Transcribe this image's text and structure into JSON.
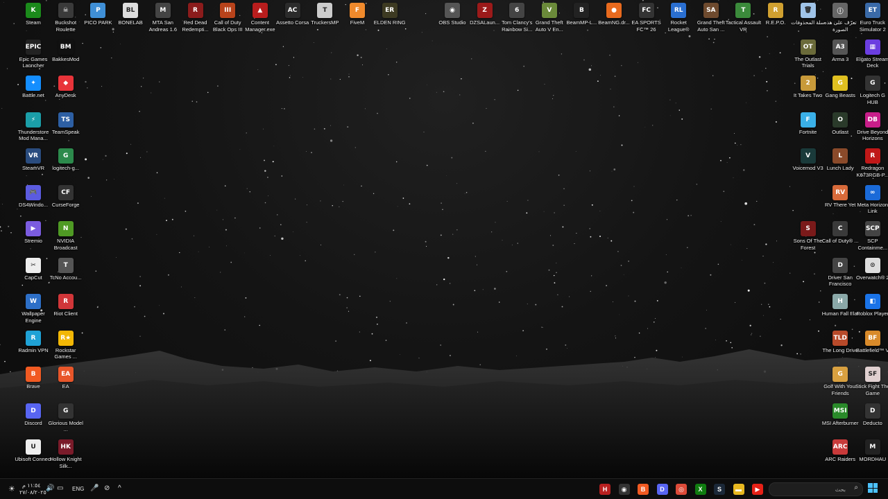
{
  "colors": {
    "accent": "#4cc2ff",
    "label_text": "#f2f2f2",
    "taskbar_bg": "#0e0e0e"
  },
  "desktop": {
    "icons": [
      {
        "id": "steam",
        "label": "Steam",
        "col": 0,
        "row": 0,
        "color": "#1b8a1b",
        "glyph": "K",
        "icon": "kick-steam-icon"
      },
      {
        "id": "buckshot-roulette",
        "label": "Buckshot Roulette",
        "col": 1,
        "row": 0,
        "color": "#3a3a3a",
        "glyph": "☠",
        "icon": "skull-icon"
      },
      {
        "id": "pico-park",
        "label": "PICO PARK",
        "col": 2,
        "row": 0,
        "color": "#3f8fd6",
        "glyph": "P",
        "icon": "pico-park-icon"
      },
      {
        "id": "bonelab",
        "label": "BONELAB",
        "col": 3,
        "row": 0,
        "color": "#ddd",
        "glyph": "BL",
        "icon": "bonelab-icon"
      },
      {
        "id": "mta-sa",
        "label": "MTA San Andreas 1.6",
        "col": 4,
        "row": 0,
        "color": "#444",
        "glyph": "M",
        "icon": "mta-icon"
      },
      {
        "id": "rdr",
        "label": "Red Dead Redempti...",
        "col": 5,
        "row": 0,
        "color": "#8b1c1c",
        "glyph": "R",
        "icon": "rdr-icon"
      },
      {
        "id": "cod-bo3",
        "label": "Call of Duty Black Ops III",
        "col": 6,
        "row": 0,
        "color": "#b8431b",
        "glyph": "III",
        "icon": "cod-icon"
      },
      {
        "id": "content-manager",
        "label": "Content Manager.exe",
        "col": 7,
        "row": 0,
        "color": "#b81d1d",
        "glyph": "▲",
        "icon": "content-manager-icon"
      },
      {
        "id": "assetto-corsa",
        "label": "Assetto Corsa",
        "col": 8,
        "row": 0,
        "color": "#2b2b2b",
        "glyph": "AC",
        "icon": "assetto-icon"
      },
      {
        "id": "truckersmp",
        "label": "TruckersMP",
        "col": 9,
        "row": 0,
        "color": "#ccc",
        "glyph": "T",
        "icon": "truck-icon"
      },
      {
        "id": "fivem",
        "label": "FiveM",
        "col": 10,
        "row": 0,
        "color": "#f08a2c",
        "glyph": "F",
        "icon": "fivem-icon"
      },
      {
        "id": "elden-ring",
        "label": "ELDEN RING",
        "col": 11,
        "row": 0,
        "color": "#3d3a22",
        "glyph": "ER",
        "icon": "elden-ring-icon"
      },
      {
        "id": "obs",
        "label": "OBS Studio",
        "col": 13,
        "row": 0,
        "color": "#555",
        "glyph": "◉",
        "icon": "obs-icon"
      },
      {
        "id": "dzsa",
        "label": "DZSALaun...",
        "col": 14,
        "row": 0,
        "color": "#9b1a1a",
        "glyph": "Z",
        "icon": "dzsa-icon"
      },
      {
        "id": "rainbow-six",
        "label": "Tom Clancy's Rainbow Si...",
        "col": 15,
        "row": 0,
        "color": "#444",
        "glyph": "6",
        "icon": "rainbow-six-icon"
      },
      {
        "id": "gta5-en",
        "label": "Grand Theft Auto V En...",
        "col": 16,
        "row": 0,
        "color": "#6b8a3a",
        "glyph": "V",
        "icon": "gta-v-icon"
      },
      {
        "id": "beammp",
        "label": "BeamMP-L...",
        "col": 17,
        "row": 0,
        "color": "#222",
        "glyph": "B",
        "icon": "beammp-icon"
      },
      {
        "id": "beamng",
        "label": "BeamNG.dr...",
        "col": 18,
        "row": 0,
        "color": "#e86a1e",
        "glyph": "●",
        "icon": "beamng-icon"
      },
      {
        "id": "ea-fc26",
        "label": "EA SPORTS FC™ 26",
        "col": 19,
        "row": 0,
        "color": "#333",
        "glyph": "FC",
        "icon": "ea-fc-icon"
      },
      {
        "id": "rocket-league",
        "label": "Rocket League®",
        "col": 20,
        "row": 0,
        "color": "#2a6fd1",
        "glyph": "RL",
        "icon": "rocket-league-icon"
      },
      {
        "id": "gta-sa",
        "label": "Grand Theft Auto San ...",
        "col": 21,
        "row": 0,
        "color": "#6e4a2e",
        "glyph": "SA",
        "icon": "gta-sa-icon"
      },
      {
        "id": "tactical-assault",
        "label": "Tactical Assault VR",
        "col": 22,
        "row": 0,
        "color": "#3b8a3b",
        "glyph": "T",
        "icon": "tactical-icon"
      },
      {
        "id": "repo",
        "label": "R.E.P.O.",
        "col": 23,
        "row": 0,
        "color": "#d0a030",
        "glyph": "R",
        "icon": "repo-icon"
      },
      {
        "id": "recycle-bin",
        "label": "سلة المحذوفات",
        "col": 24,
        "row": 0,
        "color": "#a0c4e8",
        "glyph": "🗑",
        "icon": "recycle-bin-icon"
      },
      {
        "id": "about-image",
        "label": "تعرّف على هذه الصورة",
        "col": 25,
        "row": 0,
        "color": "#666",
        "glyph": "ⓘ",
        "icon": "info-icon"
      },
      {
        "id": "ets2",
        "label": "Euro Truck Simulator 2",
        "col": 26,
        "row": 0,
        "color": "#3a6aa8",
        "glyph": "ET",
        "icon": "ets2-icon"
      },
      {
        "id": "epic",
        "label": "Epic Games Launcher",
        "col": 0,
        "row": 1,
        "color": "#222",
        "glyph": "EPIC",
        "icon": "epic-games-icon"
      },
      {
        "id": "bakkesmod",
        "label": "BakkesMod",
        "col": 1,
        "row": 1,
        "color": "#111",
        "glyph": "BM",
        "icon": "bakkesmod-icon"
      },
      {
        "id": "battlenet",
        "label": "Battle.net",
        "col": 0,
        "row": 2,
        "color": "#148eff",
        "glyph": "✦",
        "icon": "battlenet-icon"
      },
      {
        "id": "anydesk",
        "label": "AnyDesk",
        "col": 1,
        "row": 2,
        "color": "#e8343a",
        "glyph": "◆",
        "icon": "anydesk-icon"
      },
      {
        "id": "thunderstore",
        "label": "Thunderstore Mod Mana...",
        "col": 0,
        "row": 3,
        "color": "#1b9ea8",
        "glyph": "⚡",
        "icon": "thunderstore-icon"
      },
      {
        "id": "teamspeak",
        "label": "TeamSpeak",
        "col": 1,
        "row": 3,
        "color": "#2d5fa3",
        "glyph": "TS",
        "icon": "teamspeak-icon"
      },
      {
        "id": "steamvr",
        "label": "SteamVR",
        "col": 0,
        "row": 4,
        "color": "#2a4c7e",
        "glyph": "VR",
        "icon": "steamvr-icon"
      },
      {
        "id": "logitech-g",
        "label": "logitech-g...",
        "col": 1,
        "row": 4,
        "color": "#2c8a4c",
        "glyph": "G",
        "icon": "logitech-g-icon"
      },
      {
        "id": "ds4windows",
        "label": "DS4Windo...",
        "col": 0,
        "row": 5,
        "color": "#5b5be0",
        "glyph": "🎮",
        "icon": "gamepad-icon"
      },
      {
        "id": "curseforge",
        "label": "CurseForge",
        "col": 1,
        "row": 5,
        "color": "#333",
        "glyph": "CF",
        "icon": "curseforge-icon"
      },
      {
        "id": "stremio",
        "label": "Stremio",
        "col": 0,
        "row": 6,
        "color": "#7b5ce0",
        "glyph": "▶",
        "icon": "stremio-icon"
      },
      {
        "id": "nvidia",
        "label": "NVIDIA Broadcast",
        "col": 1,
        "row": 6,
        "color": "#4f9a24",
        "glyph": "N",
        "icon": "nvidia-icon"
      },
      {
        "id": "capcut",
        "label": "CapCut",
        "col": 0,
        "row": 7,
        "color": "#eee",
        "glyph": "✂",
        "icon": "capcut-icon"
      },
      {
        "id": "tcno",
        "label": "TcNo Accou...",
        "col": 1,
        "row": 7,
        "color": "#555",
        "glyph": "T",
        "icon": "tcno-icon"
      },
      {
        "id": "wallpaper-engine",
        "label": "Wallpaper Engine",
        "col": 0,
        "row": 8,
        "color": "#2d6fc7",
        "glyph": "W",
        "icon": "wallpaper-engine-icon"
      },
      {
        "id": "riot",
        "label": "Riot Client",
        "col": 1,
        "row": 8,
        "color": "#d13639",
        "glyph": "R",
        "icon": "riot-icon"
      },
      {
        "id": "radmin",
        "label": "Radmin VPN",
        "col": 0,
        "row": 9,
        "color": "#1fa2d6",
        "glyph": "R",
        "icon": "radmin-icon"
      },
      {
        "id": "rockstar",
        "label": "Rockstar Games ...",
        "col": 1,
        "row": 9,
        "color": "#f2b705",
        "glyph": "R★",
        "icon": "rockstar-icon"
      },
      {
        "id": "brave",
        "label": "Brave",
        "col": 0,
        "row": 10,
        "color": "#f15a22",
        "glyph": "B",
        "icon": "brave-icon"
      },
      {
        "id": "ea",
        "label": "EA",
        "col": 1,
        "row": 10,
        "color": "#e8562a",
        "glyph": "EA",
        "icon": "ea-icon"
      },
      {
        "id": "discord",
        "label": "Discord",
        "col": 0,
        "row": 11,
        "color": "#5865f2",
        "glyph": "D",
        "icon": "discord-icon"
      },
      {
        "id": "glorious",
        "label": "Glorious Model ...",
        "col": 1,
        "row": 11,
        "color": "#333",
        "glyph": "G",
        "icon": "glorious-icon"
      },
      {
        "id": "ubisoft",
        "label": "Ubisoft Connect",
        "col": 0,
        "row": 12,
        "color": "#eee",
        "glyph": "U",
        "icon": "ubisoft-icon"
      },
      {
        "id": "hollow-knight",
        "label": "Hollow Knight Silk...",
        "col": 1,
        "row": 12,
        "color": "#7a1b2a",
        "glyph": "HK",
        "icon": "hollow-knight-icon"
      },
      {
        "id": "outlast-trials",
        "label": "The Outlast Trials",
        "col": 24,
        "row": 1,
        "color": "#6b6b3a",
        "glyph": "OT",
        "icon": "outlast-trials-icon"
      },
      {
        "id": "arma3",
        "label": "Arma 3",
        "col": 25,
        "row": 1,
        "color": "#555",
        "glyph": "A3",
        "icon": "arma3-icon"
      },
      {
        "id": "stream-deck",
        "label": "Elgato Stream Deck",
        "col": 26,
        "row": 1,
        "color": "#6b3ee0",
        "glyph": "▦",
        "icon": "stream-deck-icon"
      },
      {
        "id": "it-takes-two",
        "label": "It Takes Two",
        "col": 24,
        "row": 2,
        "color": "#c89a3a",
        "glyph": "2",
        "icon": "it-takes-two-icon"
      },
      {
        "id": "gang-beasts",
        "label": "Gang Beasts",
        "col": 25,
        "row": 2,
        "color": "#e0c020",
        "glyph": "G",
        "icon": "gang-beasts-icon"
      },
      {
        "id": "logitech-ghub",
        "label": "Logitech G HUB",
        "col": 26,
        "row": 2,
        "color": "#333",
        "glyph": "G",
        "icon": "ghub-icon"
      },
      {
        "id": "fortnite",
        "label": "Fortnite",
        "col": 24,
        "row": 3,
        "color": "#3ab0e8",
        "glyph": "F",
        "icon": "fortnite-icon"
      },
      {
        "id": "outlast",
        "label": "Outlast",
        "col": 25,
        "row": 3,
        "color": "#2a3a2a",
        "glyph": "O",
        "icon": "outlast-icon"
      },
      {
        "id": "drive-beyond",
        "label": "Drive Beyond Horizons",
        "col": 26,
        "row": 3,
        "color": "#c81e8a",
        "glyph": "DB",
        "icon": "drive-beyond-icon"
      },
      {
        "id": "voicemod",
        "label": "Voicemod V3",
        "col": 24,
        "row": 4,
        "color": "#1a3a3a",
        "glyph": "V",
        "icon": "voicemod-icon"
      },
      {
        "id": "lunch-lady",
        "label": "Lunch Lady",
        "col": 25,
        "row": 4,
        "color": "#8a4a2a",
        "glyph": "L",
        "icon": "lunch-lady-icon"
      },
      {
        "id": "redragon",
        "label": "Redragon K673RGB-P...",
        "col": 26,
        "row": 4,
        "color": "#c01818",
        "glyph": "R",
        "icon": "redragon-icon"
      },
      {
        "id": "rv-there-yet",
        "label": "RV There Yet",
        "col": 25,
        "row": 5,
        "color": "#d86a3a",
        "glyph": "RV",
        "icon": "rv-icon"
      },
      {
        "id": "meta-horizon",
        "label": "Meta Horizon Link",
        "col": 26,
        "row": 5,
        "color": "#1a6ad8",
        "glyph": "∞",
        "icon": "meta-icon"
      },
      {
        "id": "sons-forest",
        "label": "Sons Of The Forest",
        "col": 24,
        "row": 6,
        "color": "#7a1a1a",
        "glyph": "S",
        "icon": "sons-forest-icon"
      },
      {
        "id": "cod",
        "label": "Call of Duty® ...",
        "col": 25,
        "row": 6,
        "color": "#3a3a3a",
        "glyph": "C",
        "icon": "cod-hq-icon"
      },
      {
        "id": "scp",
        "label": "SCP Containme...",
        "col": 26,
        "row": 6,
        "color": "#444",
        "glyph": "SCP",
        "icon": "scp-icon"
      },
      {
        "id": "driver-sf",
        "label": "Driver San Francisco",
        "col": 25,
        "row": 7,
        "color": "#444",
        "glyph": "D",
        "icon": "driver-icon"
      },
      {
        "id": "overwatch",
        "label": "Overwatch® 2",
        "col": 26,
        "row": 7,
        "color": "#ddd",
        "glyph": "⊙",
        "icon": "overwatch-icon"
      },
      {
        "id": "human-fall-flat",
        "label": "Human Fall Flat",
        "col": 25,
        "row": 8,
        "color": "#8aa8a8",
        "glyph": "H",
        "icon": "human-fall-flat-icon"
      },
      {
        "id": "roblox",
        "label": "Roblox Player",
        "col": 26,
        "row": 8,
        "color": "#1a73e8",
        "glyph": "◧",
        "icon": "roblox-icon"
      },
      {
        "id": "long-drive",
        "label": "The Long Drive",
        "col": 25,
        "row": 9,
        "color": "#b84a2a",
        "glyph": "TLD",
        "icon": "long-drive-icon"
      },
      {
        "id": "battlefield",
        "label": "Battlefield™ V",
        "col": 26,
        "row": 9,
        "color": "#d88a2a",
        "glyph": "BF",
        "icon": "battlefield-icon"
      },
      {
        "id": "golf-friends",
        "label": "Golf With Your Friends",
        "col": 25,
        "row": 10,
        "color": "#d8a040",
        "glyph": "G",
        "icon": "golf-icon"
      },
      {
        "id": "stick-fight",
        "label": "Stick Fight The Game",
        "col": 26,
        "row": 10,
        "color": "#e0d0d0",
        "glyph": "SF",
        "icon": "stick-fight-icon"
      },
      {
        "id": "msi-afterburner",
        "label": "MSI Afterburner",
        "col": 25,
        "row": 11,
        "color": "#2a8a2a",
        "glyph": "MSI",
        "icon": "afterburner-icon"
      },
      {
        "id": "deducto",
        "label": "Deducto",
        "col": 26,
        "row": 11,
        "color": "#333",
        "glyph": "D",
        "icon": "deducto-icon"
      },
      {
        "id": "arc-raiders",
        "label": "ARC Raiders",
        "col": 25,
        "row": 12,
        "color": "#c83a3a",
        "glyph": "ARC",
        "icon": "arc-raiders-icon"
      },
      {
        "id": "mordhau",
        "label": "MORDHAU",
        "col": 26,
        "row": 12,
        "color": "#222",
        "glyph": "M",
        "icon": "mordhau-icon"
      }
    ]
  },
  "taskbar": {
    "search_placeholder": "بحث",
    "language": "ENG",
    "clock_time": "١١:٥٤ م",
    "clock_date": "٢٧/٠٨/٢٠٢٥",
    "apps": [
      {
        "id": "hyper",
        "glyph": "H",
        "color": "#b82020",
        "icon": "hyper-icon"
      },
      {
        "id": "obs-tb",
        "glyph": "◉",
        "color": "#333",
        "icon": "obs-icon"
      },
      {
        "id": "brave-tb",
        "glyph": "B",
        "color": "#f15a22",
        "icon": "brave-icon"
      },
      {
        "id": "discord-tb",
        "glyph": "D",
        "color": "#5865f2",
        "icon": "discord-icon"
      },
      {
        "id": "chrome",
        "glyph": "◎",
        "color": "#dd4b39",
        "icon": "chrome-icon"
      },
      {
        "id": "xbox",
        "glyph": "X",
        "color": "#107c10",
        "icon": "xbox-icon"
      },
      {
        "id": "steam-tb",
        "glyph": "S",
        "color": "#1b2838",
        "icon": "steam-icon"
      },
      {
        "id": "explorer",
        "glyph": "▬",
        "color": "#e8b820",
        "icon": "folder-icon"
      },
      {
        "id": "youtube",
        "glyph": "▶",
        "color": "#e62117",
        "icon": "youtube-icon"
      }
    ]
  }
}
